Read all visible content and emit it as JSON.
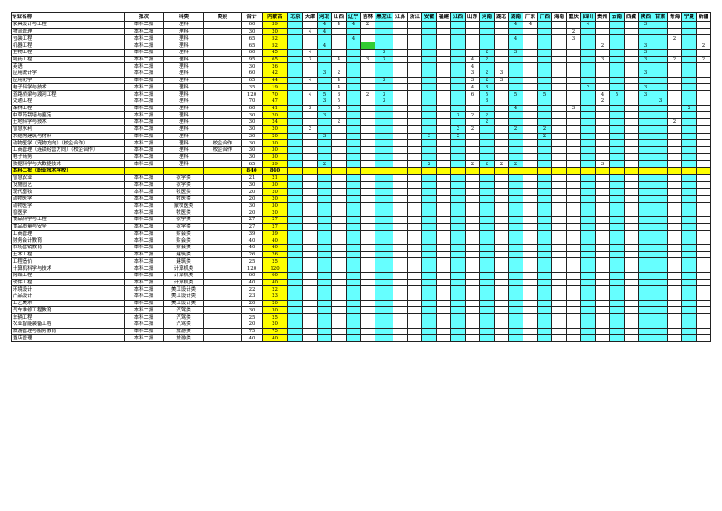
{
  "headers": [
    "专业名称",
    "批次",
    "科类",
    "类别",
    "合计",
    "内蒙古",
    "北京",
    "天津",
    "河北",
    "山西",
    "辽宁",
    "吉林",
    "黑龙江",
    "江苏",
    "浙江",
    "安徽",
    "福建",
    "江西",
    "山东",
    "河南",
    "湖北",
    "湖南",
    "广东",
    "广西",
    "海南",
    "重庆",
    "四川",
    "贵州",
    "云南",
    "西藏",
    "陕西",
    "甘肃",
    "青海",
    "宁夏",
    "新疆"
  ],
  "colors": {
    "cyan": "#66ffff",
    "yellow": "#ffff00",
    "green": "#33cc33"
  },
  "rows": [
    [
      "家具设计与工程",
      "本科二批",
      "理科",
      "",
      "60",
      "39",
      "",
      "",
      "4",
      "4",
      "4",
      "2",
      "",
      "",
      "",
      "",
      "",
      "",
      "",
      "",
      "",
      "4",
      "4",
      "",
      "",
      "",
      "4",
      "",
      "",
      "",
      "3",
      "",
      "",
      "",
      ""
    ],
    [
      "物流管理",
      "本科二批",
      "理科",
      "",
      "30",
      "20",
      "",
      "4",
      "4",
      "",
      "",
      "",
      "",
      "",
      "",
      "",
      "",
      "",
      "",
      "",
      "",
      "",
      "",
      "",
      "",
      "2",
      "",
      "",
      "",
      "",
      "",
      "",
      "",
      "",
      ""
    ],
    [
      "包装工程",
      "本科二批",
      "理科",
      "",
      "65",
      "52",
      "",
      "",
      "",
      "",
      "4",
      "",
      "",
      "",
      "",
      "",
      "",
      "",
      "",
      "",
      "",
      "4",
      "",
      "",
      "",
      "3",
      "",
      "",
      "",
      "",
      "",
      "",
      "2",
      "",
      ""
    ],
    [
      "机器工程",
      "本科二批",
      "理科",
      "",
      "65",
      "52",
      "",
      "",
      "4",
      "",
      "",
      "",
      "",
      "",
      "",
      "",
      "",
      "",
      "",
      "",
      "",
      "",
      "",
      "",
      "",
      "",
      "",
      "2",
      "",
      "",
      "3",
      "",
      "",
      "",
      "2"
    ],
    [
      "生物工程",
      "本科二批",
      "理科",
      "",
      "60",
      "45",
      "",
      "4",
      "",
      "",
      "",
      "",
      "3",
      "",
      "",
      "",
      "",
      "",
      "",
      "2",
      "",
      "3",
      "",
      "",
      "",
      "",
      "",
      "",
      "",
      "",
      "3",
      "",
      "",
      "",
      ""
    ],
    [
      "制药工程",
      "本科二批",
      "理科",
      "",
      "95",
      "65",
      "",
      "3",
      "",
      "4",
      "",
      "3",
      "3",
      "",
      "",
      "",
      "",
      "",
      "4",
      "2",
      "",
      "",
      "",
      "",
      "",
      "",
      "",
      "3",
      "",
      "",
      "3",
      "",
      "2",
      "",
      "2"
    ],
    [
      "英语",
      "本科二批",
      "理科",
      "",
      "30",
      "26",
      "",
      "",
      "",
      "",
      "",
      "",
      "",
      "",
      "",
      "",
      "",
      "",
      "4",
      "",
      "",
      "",
      "",
      "",
      "",
      "",
      "",
      "",
      "",
      "",
      "",
      "",
      "",
      "",
      ""
    ],
    [
      "应用统计学",
      "本科二批",
      "理科",
      "",
      "60",
      "42",
      "",
      "",
      "3",
      "2",
      "",
      "",
      "",
      "",
      "",
      "",
      "",
      "",
      "3",
      "2",
      "3",
      "",
      "",
      "",
      "",
      "",
      "",
      "",
      "",
      "",
      "3",
      "",
      "",
      "",
      ""
    ],
    [
      "应用化学",
      "本科二批",
      "理科",
      "",
      "65",
      "44",
      "",
      "4",
      "",
      "4",
      "",
      "",
      "3",
      "",
      "",
      "",
      "",
      "",
      "3",
      "2",
      "3",
      "",
      "",
      "",
      "",
      "",
      "",
      "",
      "",
      "",
      "",
      "",
      "",
      "",
      ""
    ],
    [
      "电子科学与技术",
      "本科二批",
      "理科",
      "",
      "35",
      "19",
      "",
      "",
      "",
      "4",
      "",
      "",
      "",
      "",
      "",
      "",
      "",
      "",
      "4",
      "3",
      "",
      "",
      "",
      "",
      "",
      "",
      "2",
      "",
      "",
      "",
      "3",
      "",
      "",
      "",
      ""
    ],
    [
      "道路桥梁与渡河工程",
      "本科二批",
      "理科",
      "",
      "120",
      "70",
      "",
      "4",
      "5",
      "3",
      "",
      "2",
      "3",
      "",
      "",
      "",
      "",
      "",
      "6",
      "5",
      "",
      "5",
      "",
      "5",
      "",
      "",
      "",
      "4",
      "5",
      "",
      "3",
      "",
      "",
      "",
      ""
    ],
    [
      "交通工程",
      "本科二批",
      "理科",
      "",
      "70",
      "47",
      "",
      "",
      "3",
      "5",
      "",
      "",
      "3",
      "",
      "",
      "",
      "",
      "",
      "",
      "3",
      "",
      "",
      "",
      "",
      "",
      "",
      "",
      "2",
      "",
      "",
      "",
      "3",
      "",
      "",
      ""
    ],
    [
      "森林工程",
      "本科二批",
      "理科",
      "",
      "60",
      "41",
      "",
      "3",
      "",
      "5",
      "",
      "",
      "",
      "",
      "",
      "",
      "",
      "",
      "",
      "",
      "",
      "4",
      "",
      "",
      "",
      "3",
      "",
      "",
      "",
      "",
      "",
      "",
      "",
      "2",
      ""
    ],
    [
      "中草药栽培与鉴定",
      "本科二批",
      "理科",
      "",
      "30",
      "20",
      "",
      "",
      "3",
      "",
      "",
      "",
      "",
      "",
      "",
      "",
      "",
      "3",
      "2",
      "2",
      "",
      "",
      "",
      "",
      "",
      "",
      "",
      "",
      "",
      "",
      "",
      "",
      "",
      "",
      ""
    ],
    [
      "土地科学与技术",
      "本科二批",
      "理科",
      "",
      "30",
      "24",
      "",
      "",
      "",
      "2",
      "",
      "",
      "",
      "",
      "",
      "",
      "",
      "",
      "",
      "2",
      "",
      "",
      "",
      "",
      "",
      "",
      "",
      "",
      "",
      "",
      "",
      "",
      "2",
      "",
      ""
    ],
    [
      "智慧水利",
      "本科二批",
      "理科",
      "",
      "30",
      "20",
      "",
      "2",
      "",
      "",
      "",
      "",
      "",
      "",
      "",
      "",
      "",
      "2",
      "2",
      "",
      "",
      "2",
      "",
      "2",
      "",
      "",
      "",
      "",
      "",
      "",
      "",
      "",
      "",
      "",
      ""
    ],
    [
      "木结构建筑与材料",
      "本科二批",
      "理科",
      "",
      "30",
      "20",
      "",
      "",
      "3",
      "",
      "",
      "",
      "",
      "",
      "",
      "3",
      "",
      "2",
      "",
      "",
      "",
      "",
      "",
      "2",
      "",
      "",
      "",
      "",
      "",
      "",
      "",
      "",
      "",
      "",
      ""
    ],
    [
      "动物医学（宠物方向）（校企合作）",
      "本科二批",
      "理科",
      "校企合作",
      "30",
      "30",
      "",
      "",
      "",
      "",
      "",
      "",
      "",
      "",
      "",
      "",
      "",
      "",
      "",
      "",
      "",
      "",
      "",
      "",
      "",
      "",
      "",
      "",
      "",
      "",
      "",
      "",
      "",
      "",
      ""
    ],
    [
      "工商管理（连锁经营方向）（校企合作）",
      "本科二批",
      "理科",
      "校企合作",
      "30",
      "30",
      "",
      "",
      "",
      "",
      "",
      "",
      "",
      "",
      "",
      "",
      "",
      "",
      "",
      "",
      "",
      "",
      "",
      "",
      "",
      "",
      "",
      "",
      "",
      "",
      "",
      "",
      "",
      "",
      ""
    ],
    [
      "电子商务",
      "本科二批",
      "理科",
      "",
      "30",
      "30",
      "",
      "",
      "",
      "",
      "",
      "",
      "",
      "",
      "",
      "",
      "",
      "",
      "",
      "",
      "",
      "",
      "",
      "",
      "",
      "",
      "",
      "",
      "",
      "",
      "",
      "",
      "",
      "",
      ""
    ],
    [
      "数据科学与大数据技术",
      "本科二批",
      "理科",
      "",
      "65",
      "39",
      "",
      "",
      "2",
      "",
      "",
      "",
      "",
      "",
      "",
      "2",
      "",
      "",
      "2",
      "2",
      "2",
      "2",
      "",
      "",
      "",
      "",
      "",
      "3",
      "",
      "",
      "",
      "",
      "",
      "",
      ""
    ],
    [
      "本科二批（职业技术学校）",
      "",
      "",
      "",
      "840",
      "840",
      "",
      "",
      "",
      "",
      "",
      "",
      "",
      "",
      "",
      "",
      "",
      "",
      "",
      "",
      "",
      "",
      "",
      "",
      "",
      "",
      "",
      "",
      "",
      "",
      "",
      "",
      "",
      "",
      ""
    ],
    [
      "智慧农业",
      "本科二批",
      "农学类",
      "",
      "21",
      "21",
      "",
      "",
      "",
      "",
      "",
      "",
      "",
      "",
      "",
      "",
      "",
      "",
      "",
      "",
      "",
      "",
      "",
      "",
      "",
      "",
      "",
      "",
      "",
      "",
      "",
      "",
      "",
      "",
      ""
    ],
    [
      "设施园艺",
      "本科二批",
      "农学类",
      "",
      "30",
      "30",
      "",
      "",
      "",
      "",
      "",
      "",
      "",
      "",
      "",
      "",
      "",
      "",
      "",
      "",
      "",
      "",
      "",
      "",
      "",
      "",
      "",
      "",
      "",
      "",
      "",
      "",
      "",
      "",
      ""
    ],
    [
      "现代畜牧",
      "本科二批",
      "牧医类",
      "",
      "20",
      "20",
      "",
      "",
      "",
      "",
      "",
      "",
      "",
      "",
      "",
      "",
      "",
      "",
      "",
      "",
      "",
      "",
      "",
      "",
      "",
      "",
      "",
      "",
      "",
      "",
      "",
      "",
      "",
      "",
      ""
    ],
    [
      "动物医学",
      "本科二批",
      "牧医类",
      "",
      "20",
      "20",
      "",
      "",
      "",
      "",
      "",
      "",
      "",
      "",
      "",
      "",
      "",
      "",
      "",
      "",
      "",
      "",
      "",
      "",
      "",
      "",
      "",
      "",
      "",
      "",
      "",
      "",
      "",
      "",
      ""
    ],
    [
      "动物医学",
      "本科二批",
      "蒙牧医类",
      "",
      "30",
      "30",
      "",
      "",
      "",
      "",
      "",
      "",
      "",
      "",
      "",
      "",
      "",
      "",
      "",
      "",
      "",
      "",
      "",
      "",
      "",
      "",
      "",
      "",
      "",
      "",
      "",
      "",
      "",
      "",
      ""
    ],
    [
      "兽医学",
      "本科二批",
      "牧医类",
      "",
      "20",
      "20",
      "",
      "",
      "",
      "",
      "",
      "",
      "",
      "",
      "",
      "",
      "",
      "",
      "",
      "",
      "",
      "",
      "",
      "",
      "",
      "",
      "",
      "",
      "",
      "",
      "",
      "",
      "",
      "",
      ""
    ],
    [
      "食品科学与工程",
      "本科二批",
      "农学类",
      "",
      "27",
      "27",
      "",
      "",
      "",
      "",
      "",
      "",
      "",
      "",
      "",
      "",
      "",
      "",
      "",
      "",
      "",
      "",
      "",
      "",
      "",
      "",
      "",
      "",
      "",
      "",
      "",
      "",
      "",
      "",
      ""
    ],
    [
      "食品质量与安全",
      "本科二批",
      "农学类",
      "",
      "27",
      "27",
      "",
      "",
      "",
      "",
      "",
      "",
      "",
      "",
      "",
      "",
      "",
      "",
      "",
      "",
      "",
      "",
      "",
      "",
      "",
      "",
      "",
      "",
      "",
      "",
      "",
      "",
      "",
      "",
      ""
    ],
    [
      "工商管理",
      "本科二批",
      "财会类",
      "",
      "39",
      "39",
      "",
      "",
      "",
      "",
      "",
      "",
      "",
      "",
      "",
      "",
      "",
      "",
      "",
      "",
      "",
      "",
      "",
      "",
      "",
      "",
      "",
      "",
      "",
      "",
      "",
      "",
      "",
      "",
      ""
    ],
    [
      "财务会计教育",
      "本科二批",
      "财会类",
      "",
      "40",
      "40",
      "",
      "",
      "",
      "",
      "",
      "",
      "",
      "",
      "",
      "",
      "",
      "",
      "",
      "",
      "",
      "",
      "",
      "",
      "",
      "",
      "",
      "",
      "",
      "",
      "",
      "",
      "",
      "",
      ""
    ],
    [
      "市场营销教育",
      "本科二批",
      "财会类",
      "",
      "40",
      "40",
      "",
      "",
      "",
      "",
      "",
      "",
      "",
      "",
      "",
      "",
      "",
      "",
      "",
      "",
      "",
      "",
      "",
      "",
      "",
      "",
      "",
      "",
      "",
      "",
      "",
      "",
      "",
      "",
      ""
    ],
    [
      "土木工程",
      "本科二批",
      "建筑类",
      "",
      "26",
      "26",
      "",
      "",
      "",
      "",
      "",
      "",
      "",
      "",
      "",
      "",
      "",
      "",
      "",
      "",
      "",
      "",
      "",
      "",
      "",
      "",
      "",
      "",
      "",
      "",
      "",
      "",
      "",
      "",
      ""
    ],
    [
      "工程造价",
      "本科二批",
      "建筑类",
      "",
      "25",
      "25",
      "",
      "",
      "",
      "",
      "",
      "",
      "",
      "",
      "",
      "",
      "",
      "",
      "",
      "",
      "",
      "",
      "",
      "",
      "",
      "",
      "",
      "",
      "",
      "",
      "",
      "",
      "",
      "",
      ""
    ],
    [
      "计算机科学与技术",
      "本科二批",
      "计算机类",
      "",
      "120",
      "120",
      "",
      "",
      "",
      "",
      "",
      "",
      "",
      "",
      "",
      "",
      "",
      "",
      "",
      "",
      "",
      "",
      "",
      "",
      "",
      "",
      "",
      "",
      "",
      "",
      "",
      "",
      "",
      "",
      ""
    ],
    [
      "网络工程",
      "本科二批",
      "计算机类",
      "",
      "60",
      "60",
      "",
      "",
      "",
      "",
      "",
      "",
      "",
      "",
      "",
      "",
      "",
      "",
      "",
      "",
      "",
      "",
      "",
      "",
      "",
      "",
      "",
      "",
      "",
      "",
      "",
      "",
      "",
      "",
      ""
    ],
    [
      "软件工程",
      "本科二批",
      "计算机类",
      "",
      "40",
      "40",
      "",
      "",
      "",
      "",
      "",
      "",
      "",
      "",
      "",
      "",
      "",
      "",
      "",
      "",
      "",
      "",
      "",
      "",
      "",
      "",
      "",
      "",
      "",
      "",
      "",
      "",
      "",
      "",
      ""
    ],
    [
      "环境设计",
      "本科二批",
      "美工设计类",
      "",
      "22",
      "22",
      "",
      "",
      "",
      "",
      "",
      "",
      "",
      "",
      "",
      "",
      "",
      "",
      "",
      "",
      "",
      "",
      "",
      "",
      "",
      "",
      "",
      "",
      "",
      "",
      "",
      "",
      "",
      "",
      ""
    ],
    [
      "产品设计",
      "本科二批",
      "美工设计类",
      "",
      "23",
      "23",
      "",
      "",
      "",
      "",
      "",
      "",
      "",
      "",
      "",
      "",
      "",
      "",
      "",
      "",
      "",
      "",
      "",
      "",
      "",
      "",
      "",
      "",
      "",
      "",
      "",
      "",
      "",
      "",
      ""
    ],
    [
      "工艺美术",
      "本科二批",
      "美工设计类",
      "",
      "20",
      "20",
      "",
      "",
      "",
      "",
      "",
      "",
      "",
      "",
      "",
      "",
      "",
      "",
      "",
      "",
      "",
      "",
      "",
      "",
      "",
      "",
      "",
      "",
      "",
      "",
      "",
      "",
      "",
      "",
      ""
    ],
    [
      "汽车维修工程教育",
      "本科二批",
      "汽驾类",
      "",
      "30",
      "30",
      "",
      "",
      "",
      "",
      "",
      "",
      "",
      "",
      "",
      "",
      "",
      "",
      "",
      "",
      "",
      "",
      "",
      "",
      "",
      "",
      "",
      "",
      "",
      "",
      "",
      "",
      "",
      "",
      ""
    ],
    [
      "车辆工程",
      "本科二批",
      "汽驾类",
      "",
      "25",
      "25",
      "",
      "",
      "",
      "",
      "",
      "",
      "",
      "",
      "",
      "",
      "",
      "",
      "",
      "",
      "",
      "",
      "",
      "",
      "",
      "",
      "",
      "",
      "",
      "",
      "",
      "",
      "",
      "",
      ""
    ],
    [
      "农业智能装备工程",
      "本科二批",
      "汽驾类",
      "",
      "20",
      "20",
      "",
      "",
      "",
      "",
      "",
      "",
      "",
      "",
      "",
      "",
      "",
      "",
      "",
      "",
      "",
      "",
      "",
      "",
      "",
      "",
      "",
      "",
      "",
      "",
      "",
      "",
      "",
      "",
      ""
    ],
    [
      "旅游管理与服务教育",
      "本科二批",
      "旅游类",
      "",
      "75",
      "75",
      "",
      "",
      "",
      "",
      "",
      "",
      "",
      "",
      "",
      "",
      "",
      "",
      "",
      "",
      "",
      "",
      "",
      "",
      "",
      "",
      "",
      "",
      "",
      "",
      "",
      "",
      "",
      "",
      ""
    ],
    [
      "酒店管理",
      "本科二批",
      "旅游类",
      "",
      "40",
      "40",
      "",
      "",
      "",
      "",
      "",
      "",
      "",
      "",
      "",
      "",
      "",
      "",
      "",
      "",
      "",
      "",
      "",
      "",
      "",
      "",
      "",
      "",
      "",
      "",
      "",
      "",
      "",
      "",
      ""
    ]
  ]
}
